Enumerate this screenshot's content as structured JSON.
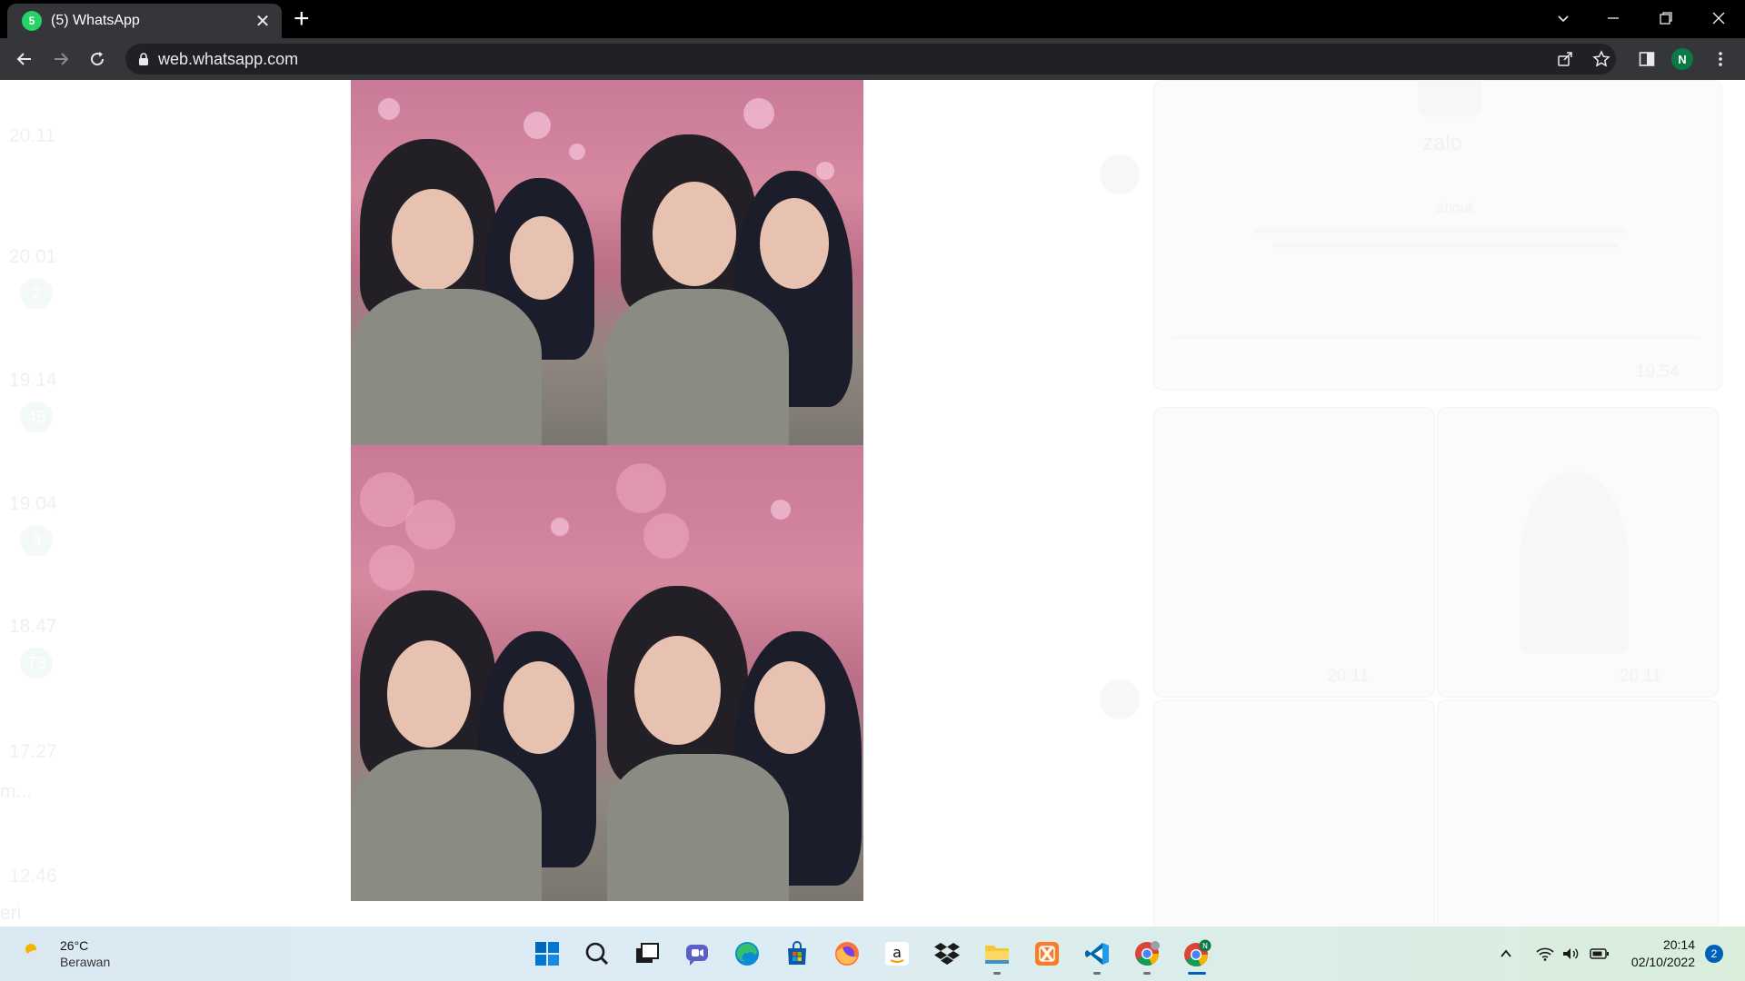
{
  "browser": {
    "tab_title": "(5) WhatsApp",
    "tab_favicon_badge": "5",
    "url": "web.whatsapp.com",
    "profile_initial": "N"
  },
  "background_chat": {
    "list_times": [
      "20.11",
      "20.01",
      "19.14",
      "19.04",
      "18.47",
      "17.27",
      "12.46"
    ],
    "list_badges": [
      "2",
      "45",
      "3",
      "73"
    ],
    "list_fragments": [
      "m...",
      "eri"
    ],
    "right_texts": {
      "app_name": "zalo",
      "app_about": "about",
      "timestamps": [
        "19.54",
        "20.11",
        "20.11"
      ]
    }
  },
  "media_viewer": {
    "photo_count": 4
  },
  "taskbar": {
    "weather_temp": "26°C",
    "weather_condition": "Berawan",
    "apps": [
      "windows-start-icon",
      "search-icon",
      "task-view-icon",
      "teams-chat-icon",
      "edge-icon",
      "microsoft-store-icon",
      "firefox-icon",
      "amazon-icon",
      "dropbox-icon",
      "file-explorer-icon",
      "xampp-icon",
      "vscode-icon",
      "chrome-icon",
      "chrome-profile-icon"
    ],
    "clock_time": "20:14",
    "clock_date": "02/10/2022",
    "notification_count": "2"
  },
  "colors": {
    "whatsapp_green": "#25d366",
    "chrome_dark": "#35363a",
    "profile_green": "#0b7a46",
    "taskbar_accent": "#005fb8"
  }
}
